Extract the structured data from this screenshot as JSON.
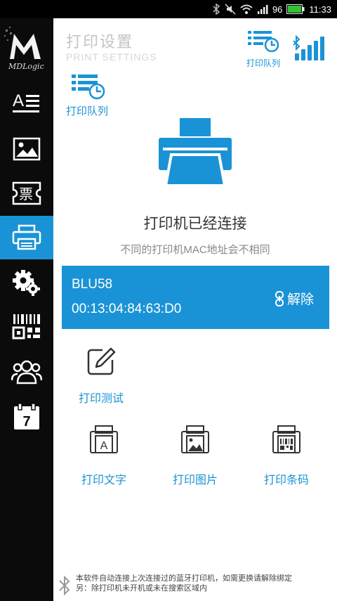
{
  "status_bar": {
    "battery": "96",
    "time": "11:33"
  },
  "app": {
    "logo_text": "MDLogic"
  },
  "sidebar": {
    "items": [
      {
        "name": "text",
        "icon": "text-align-icon"
      },
      {
        "name": "image",
        "icon": "image-icon"
      },
      {
        "name": "ticket",
        "icon": "ticket-icon",
        "glyph": "票"
      },
      {
        "name": "printer",
        "icon": "printer-icon",
        "active": true
      },
      {
        "name": "settings",
        "icon": "gears-icon"
      },
      {
        "name": "barcode",
        "icon": "barcode-qr-icon"
      },
      {
        "name": "users",
        "icon": "users-icon"
      },
      {
        "name": "calendar",
        "icon": "calendar-icon",
        "glyph": "7"
      }
    ]
  },
  "header": {
    "title": "打印设置",
    "subtitle": "PRINT SETTINGS",
    "queue_label": "打印队列"
  },
  "queue_left": {
    "label": "打印队列"
  },
  "printer_status": {
    "connected_text": "打印机已经连接",
    "note": "不同的打印机MAC地址会不相同"
  },
  "device": {
    "name": "BLU58",
    "mac": "00:13:04:84:63:D0",
    "unbind_label": "解除"
  },
  "actions": {
    "test": "打印测试",
    "text": "打印文字",
    "image": "打印图片",
    "barcode": "打印条码"
  },
  "footer": {
    "line1": "本软件自动连接上次连接过的蓝牙打印机，如需更换请解除绑定",
    "line2": "另：除打印机未开机或未在搜索区域内"
  },
  "colors": {
    "accent": "#1a93d6",
    "sidebar_bg": "#0b0b0b",
    "statusbar_bg": "#000000"
  }
}
